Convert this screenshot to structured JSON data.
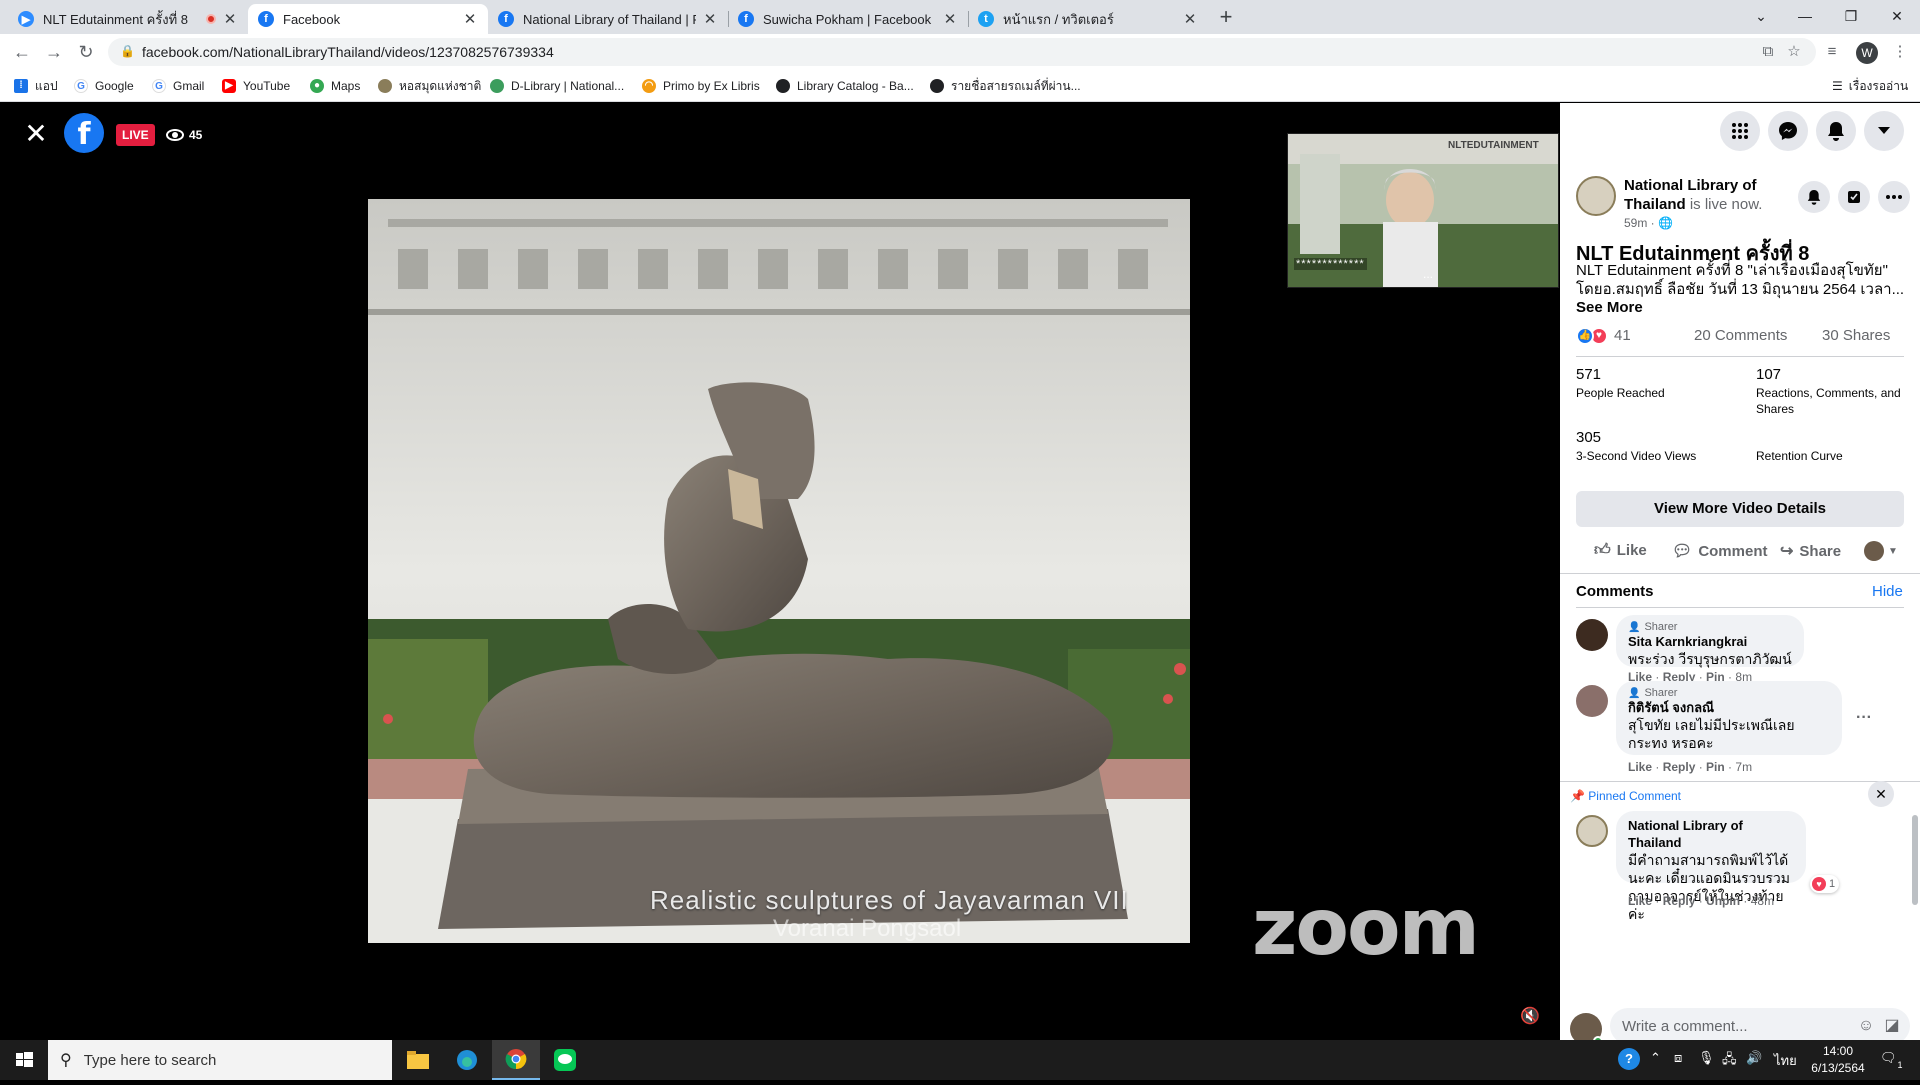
{
  "browser": {
    "tabs": [
      {
        "title": "NLT Edutainment ครั้งที่ 8",
        "favicon": "zoom-icon",
        "recording": true
      },
      {
        "title": "Facebook",
        "favicon": "facebook-icon",
        "active": true
      },
      {
        "title": "National Library of Thailand | Fac",
        "favicon": "facebook-icon"
      },
      {
        "title": "Suwicha Pokham | Facebook",
        "favicon": "facebook-icon"
      },
      {
        "title": "หน้าแรก / ทวิตเตอร์",
        "favicon": "twitter-icon"
      }
    ],
    "url": "facebook.com/NationalLibraryThailand/videos/1237082576739334",
    "bookmarks": [
      {
        "label": "แอป",
        "icon": "apps-icon"
      },
      {
        "label": "Google",
        "icon": "google-icon"
      },
      {
        "label": "Gmail",
        "icon": "google-icon"
      },
      {
        "label": "YouTube",
        "icon": "youtube-icon"
      },
      {
        "label": "Maps",
        "icon": "maps-icon"
      },
      {
        "label": "หอสมุดแห่งชาติ",
        "icon": "globe-icon"
      },
      {
        "label": "D-Library | National...",
        "icon": "globe-icon"
      },
      {
        "label": "Primo by Ex Libris",
        "icon": "primo-icon"
      },
      {
        "label": "Library Catalog - Ba...",
        "icon": "globe-icon"
      },
      {
        "label": "รายชื่อสายรถเมล์ที่ผ่าน...",
        "icon": "globe-icon"
      }
    ],
    "reading_list": "เรื่องรออ่าน"
  },
  "video": {
    "live_label": "LIVE",
    "viewer_count": "45",
    "slide_caption": "Realistic sculptures of Jayavarman VII",
    "slide_caption_partial": "Voranai Pongsaol",
    "thumb_name": "*************",
    "thumb_more": "...",
    "thumb_banner": "NLTEDUTAINMENT",
    "zoom_wordmark": "zoom"
  },
  "panel": {
    "page_name": "National Library of Thailand",
    "live_text": "is live now.",
    "time": "59m ·",
    "post_title": "NLT Edutainment ครั้งที่ 8",
    "post_desc": "NLT Edutainment ครั้งที่ 8 \"เล่าเรื่องเมืองสุโขทัย\" โดยอ.สมฤทธิ์ ลือชัย วันที่ 13 มิถุนายน 2564 เวลา...",
    "see_more": "See More",
    "reactions_count": "41",
    "comments_count": "20 Comments",
    "shares_count": "30 Shares",
    "stats": [
      {
        "num": "571",
        "label": "People Reached"
      },
      {
        "num": "107",
        "label": "Reactions, Comments, and Shares"
      },
      {
        "num": "305",
        "label": "3-Second Video Views"
      },
      {
        "num": "",
        "label": "Retention Curve"
      }
    ],
    "view_more": "View More Video Details",
    "actions": {
      "like": "Like",
      "comment": "Comment",
      "share": "Share"
    },
    "comments_title": "Comments",
    "comments_hide": "Hide",
    "comments": [
      {
        "badge": "Sharer",
        "name": "Sita Karnkriangkrai",
        "text": "พระร่วง วีรบุรุษกรตาภิวัฒน์",
        "meta_like": "Like",
        "meta_reply": "Reply",
        "meta_pin": "Pin",
        "time": "8m"
      },
      {
        "badge": "Sharer",
        "name": "กิติรัตน์ จงกลณี",
        "text": "สุโขทัย เลยไม่มีประเพณีเลยกระทง หรอคะ",
        "meta_like": "Like",
        "meta_reply": "Reply",
        "meta_pin": "Pin",
        "time": "7m"
      }
    ],
    "pinned_label": "Pinned Comment",
    "pinned": {
      "name": "National Library of Thailand",
      "text": "มีคำถามสามารถพิมพ์ไว้ได้นะคะ เดี๋ยวแอดมินรวบรวมถามอาจารย์ให้ในช่วงท้ายค่ะ",
      "meta_like": "Like",
      "meta_reply": "Reply",
      "meta_unpin": "Unpin",
      "time": "48m",
      "heart_count": "1"
    },
    "write_placeholder": "Write a comment..."
  },
  "taskbar": {
    "search_placeholder": "Type here to search",
    "lang": "ไทย",
    "time": "14:00",
    "date": "6/13/2564",
    "notif_count": "1"
  }
}
